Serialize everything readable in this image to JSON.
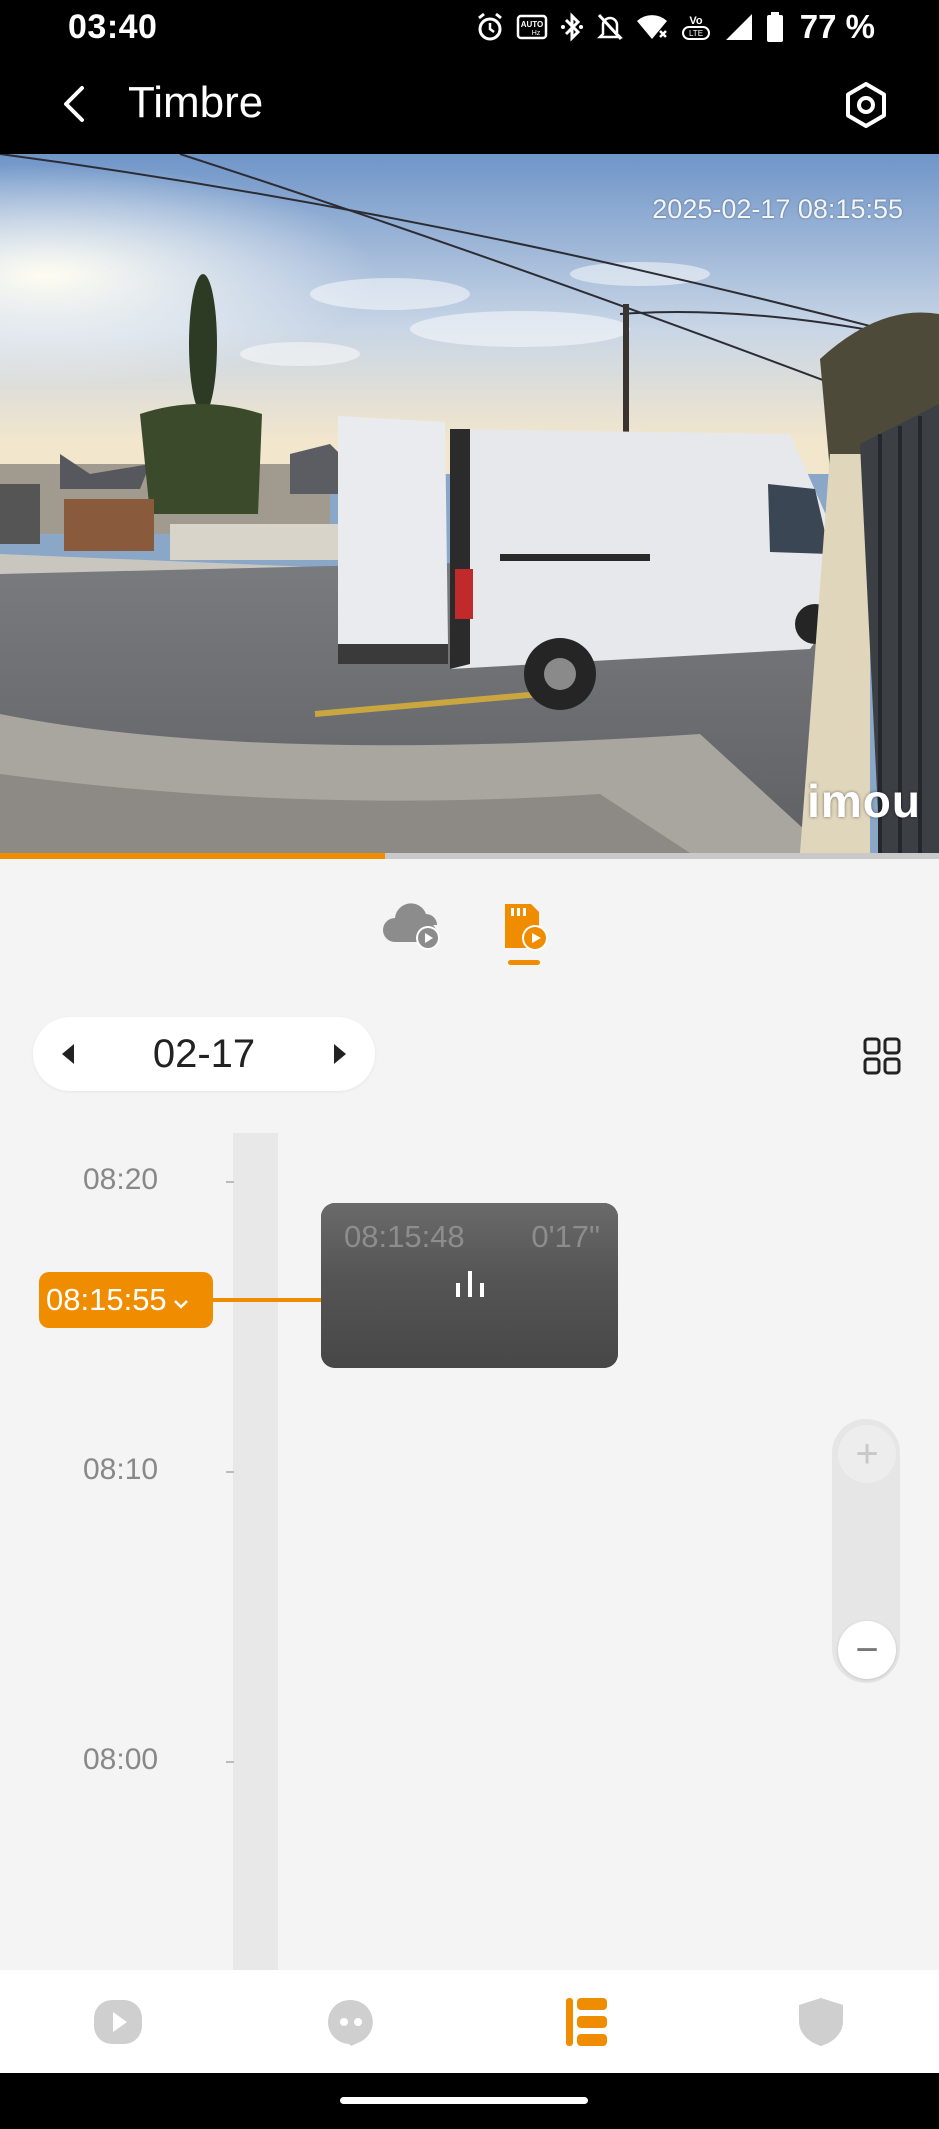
{
  "status_bar": {
    "time": "03:40",
    "battery_pct": "77 %",
    "icons": [
      "alarm-icon",
      "auto-hd-icon",
      "bluetooth-icon",
      "mute-icon",
      "wifi-icon",
      "volte-icon",
      "signal-icon",
      "battery-icon"
    ]
  },
  "app_bar": {
    "title": "Timbre",
    "back_icon": "back-arrow-icon",
    "settings_icon": "settings-icon"
  },
  "video": {
    "timestamp": "2025-02-17 08:15:55",
    "watermark": "imou",
    "progress_fraction": 0.41
  },
  "source_toggle": {
    "options": [
      "cloud-playback",
      "sd-card-playback"
    ],
    "selected": "sd-card-playback"
  },
  "date_selector": {
    "date": "02-17"
  },
  "timeline": {
    "ticks": [
      "08:20",
      "08:10",
      "08:00"
    ],
    "cursor_time": "08:15:55",
    "clip": {
      "start": "08:15:48",
      "duration": "0'17\""
    },
    "zoom_in": "+",
    "zoom_out": "−"
  },
  "bottom_nav": {
    "tabs": [
      "live-view",
      "messages",
      "recordings",
      "security"
    ],
    "active": "recordings"
  },
  "colors": {
    "accent": "#f08c00",
    "background": "#f4f4f4",
    "topbar": "#000000"
  }
}
